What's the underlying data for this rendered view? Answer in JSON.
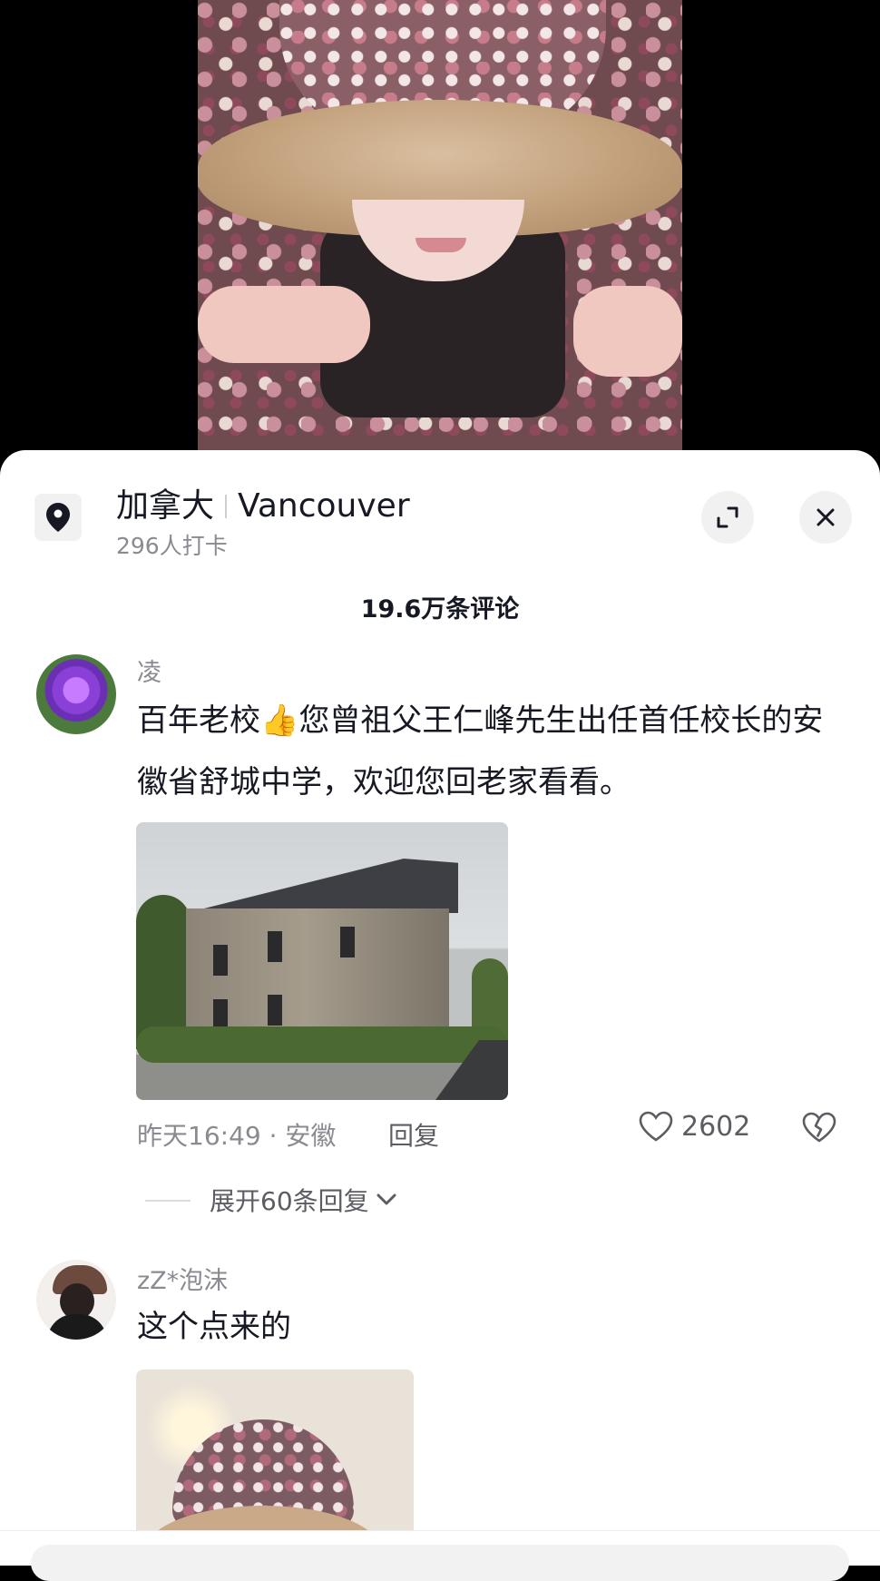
{
  "location": {
    "country": "加拿大",
    "city": "Vancouver",
    "checkins": "296人打卡"
  },
  "comments_count": "19.6万条评论",
  "comments": [
    {
      "username": "凌",
      "text_before": "百年老校",
      "emoji": "👍",
      "text_after": "您曾祖父王仁峰先生出任首任校长的安徽省舒城中学，欢迎您回老家看看。",
      "meta": "昨天16:49 · 安徽",
      "reply_label": "回复",
      "likes": "2602",
      "expand_replies": "展开60条回复"
    },
    {
      "username": "zZ*泡沫",
      "text": "这个点来的"
    }
  ],
  "icons": {
    "location": "map-pin-icon",
    "expand": "expand-icon",
    "close": "close-icon",
    "like": "heart-icon",
    "dislike": "broken-heart-icon",
    "chevron": "chevron-down-icon"
  }
}
